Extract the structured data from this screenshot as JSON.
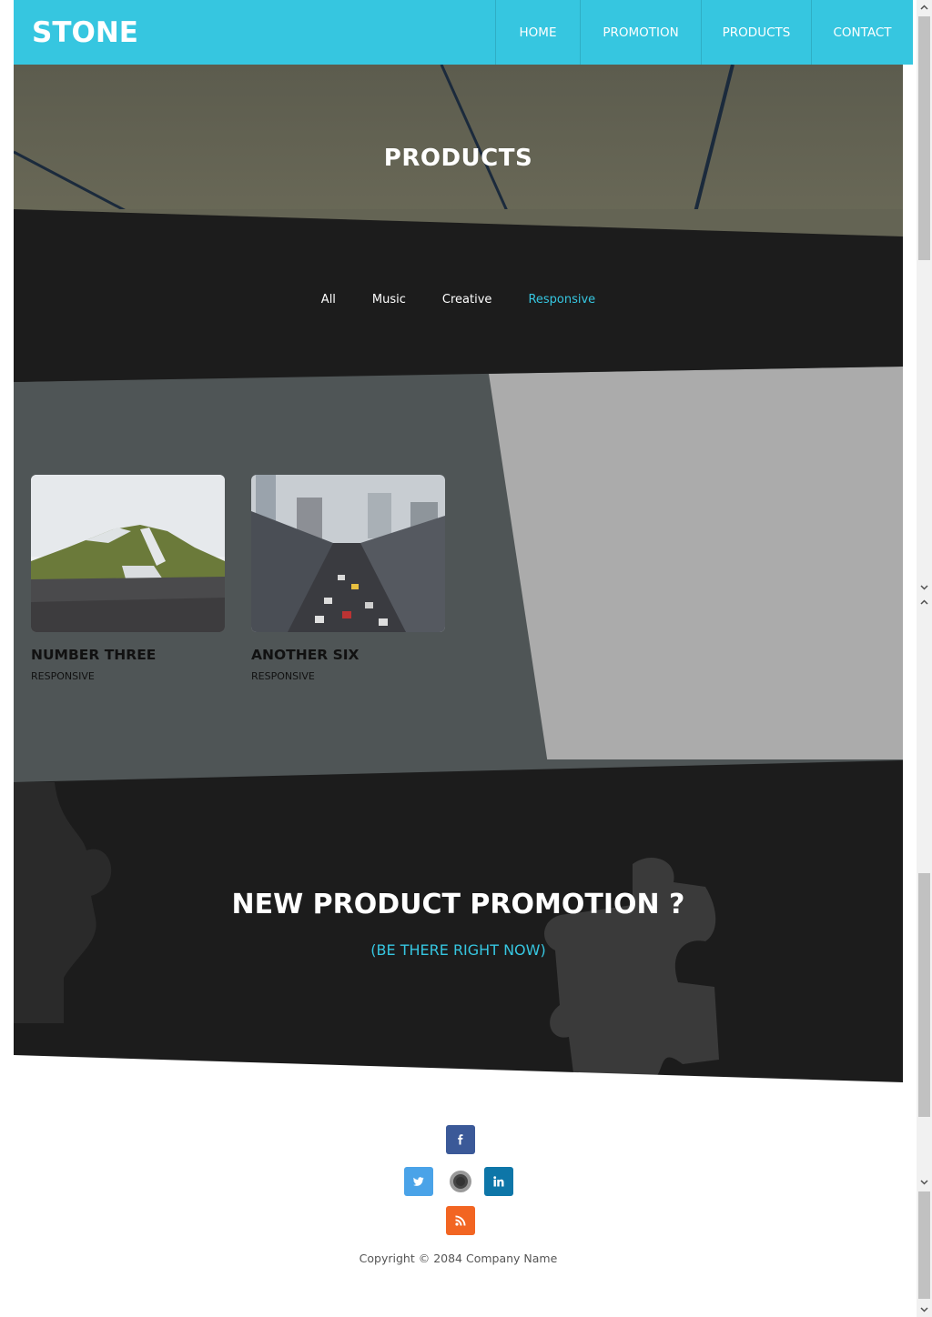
{
  "header": {
    "brand": "STONE",
    "nav": [
      {
        "label": "HOME"
      },
      {
        "label": "PROMOTION"
      },
      {
        "label": "PRODUCTS"
      },
      {
        "label": "CONTACT"
      }
    ]
  },
  "hero": {
    "title": "PRODUCTS"
  },
  "filters": {
    "items": [
      {
        "label": "All"
      },
      {
        "label": "Music"
      },
      {
        "label": "Creative"
      },
      {
        "label": "Responsive"
      }
    ],
    "active_color": "#36c6e0"
  },
  "portfolio": {
    "items": [
      {
        "title": "NUMBER THREE",
        "category": "RESPONSIVE"
      },
      {
        "title": "ANOTHER SIX",
        "category": "RESPONSIVE"
      }
    ]
  },
  "promo": {
    "title": "NEW PRODUCT PROMOTION ?",
    "link": "(BE THERE RIGHT NOW)"
  },
  "footer": {
    "social": [
      {
        "icon": "facebook-icon",
        "color": "#3b5998"
      },
      {
        "icon": "twitter-icon",
        "color": "#4aa3e8"
      },
      {
        "icon": "dribbble-icon",
        "color": "#666666"
      },
      {
        "icon": "linkedin-icon",
        "color": "#0e76a8"
      },
      {
        "icon": "rss-icon",
        "color": "#f26522"
      }
    ],
    "copyright": "Copyright © 2084 Company Name"
  },
  "colors": {
    "accent": "#36c6e0",
    "dark": "#1c1c1c"
  }
}
